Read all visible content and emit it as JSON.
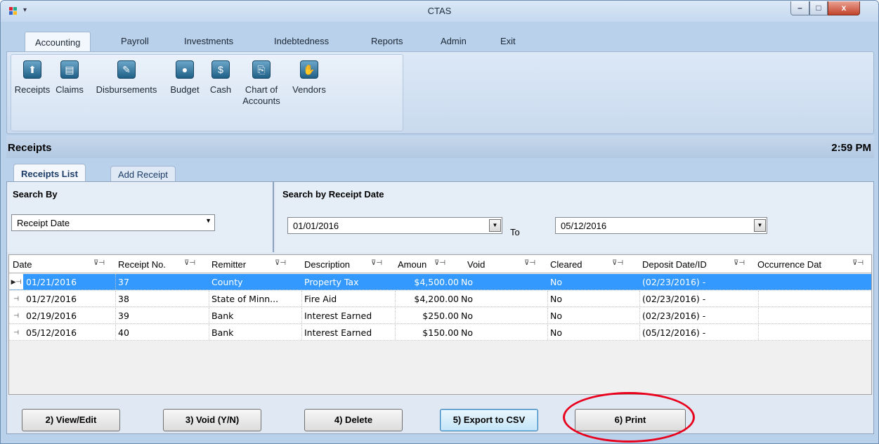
{
  "window": {
    "title": "CTAS",
    "minimize": "–",
    "maximize": "□",
    "close": "x"
  },
  "ribbon": {
    "tabs": [
      {
        "label": "Accounting"
      },
      {
        "label": "Payroll"
      },
      {
        "label": "Investments"
      },
      {
        "label": "Indebtedness"
      },
      {
        "label": "Reports"
      },
      {
        "label": "Admin"
      },
      {
        "label": "Exit"
      }
    ],
    "buttons": [
      {
        "label": "Receipts",
        "icon": "receipts-icon",
        "glyph": "⬆"
      },
      {
        "label": "Claims",
        "icon": "claims-icon",
        "glyph": "▤"
      },
      {
        "label": "Disbursements",
        "icon": "disbursements-icon",
        "glyph": "✎"
      },
      {
        "label": "Budget",
        "icon": "piggy-bank-icon",
        "glyph": "●"
      },
      {
        "label": "Cash",
        "icon": "cash-icon",
        "glyph": "$"
      },
      {
        "label": "Chart of Accounts",
        "icon": "chart-of-accounts-icon",
        "glyph": "⎘"
      },
      {
        "label": "Vendors",
        "icon": "handshake-icon",
        "glyph": "✋"
      }
    ]
  },
  "section": {
    "title": "Receipts",
    "time": "2:59 PM"
  },
  "subtabs": [
    {
      "label": "Receipts List"
    },
    {
      "label": "Add Receipt"
    }
  ],
  "search": {
    "by_label": "Search By",
    "by_value": "Receipt Date",
    "date_label": "Search by Receipt Date",
    "from": "01/01/2016",
    "to_label": "To",
    "to": "05/12/2016"
  },
  "grid": {
    "columns": [
      "Date",
      "Receipt No.",
      "Remitter",
      "Description",
      "Amoun",
      "Void",
      "Cleared",
      "Deposit Date/ID",
      "Occurrence Dat"
    ],
    "rows": [
      {
        "date": "01/21/2016",
        "receipt_no": "37",
        "remitter": "County",
        "description": "Property Tax",
        "amount": "$4,500.00",
        "void": "No",
        "cleared": "No",
        "deposit": "(02/23/2016) -",
        "occurrence": ""
      },
      {
        "date": "01/27/2016",
        "receipt_no": "38",
        "remitter": "State of Minn...",
        "description": "Fire Aid",
        "amount": "$4,200.00",
        "void": "No",
        "cleared": "No",
        "deposit": "(02/23/2016) -",
        "occurrence": ""
      },
      {
        "date": "02/19/2016",
        "receipt_no": "39",
        "remitter": "Bank",
        "description": "Interest Earned",
        "amount": "$250.00",
        "void": "No",
        "cleared": "No",
        "deposit": "(02/23/2016) -",
        "occurrence": ""
      },
      {
        "date": "05/12/2016",
        "receipt_no": "40",
        "remitter": "Bank",
        "description": "Interest Earned",
        "amount": "$150.00",
        "void": "No",
        "cleared": "No",
        "deposit": "(05/12/2016) -",
        "occurrence": ""
      }
    ],
    "selected_row": 0
  },
  "buttons": {
    "view_edit": "2) View/Edit",
    "void": "3) Void (Y/N)",
    "delete": "4) Delete",
    "export": "5) Export to CSV",
    "print": "6) Print"
  },
  "colors": {
    "selection": "#3399ff",
    "annotation": "#e8001c",
    "chrome": "#b9d1ea"
  }
}
